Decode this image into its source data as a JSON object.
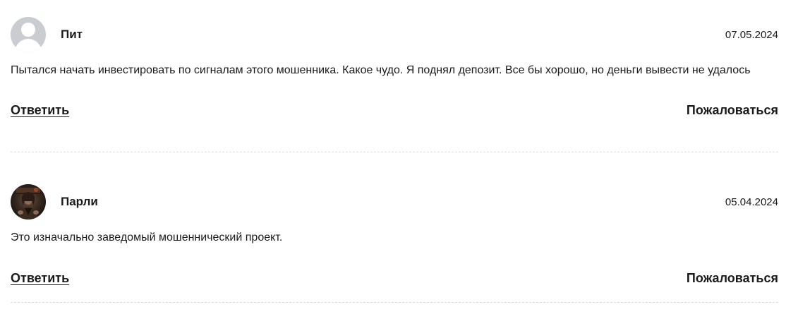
{
  "comments": [
    {
      "author": "Пит",
      "avatar_icon": "user-placeholder-icon",
      "date": "07.05.2024",
      "text": "Пытался начать инвестировать по сигналам этого мошенника. Какое чудо. Я поднял депозит. Все бы хорошо, но деньги вывести не удалось",
      "reply_label": "Ответить",
      "report_label": "Пожаловаться"
    },
    {
      "author": "Парли",
      "avatar_icon": "user-photo",
      "date": "05.04.2024",
      "text": "Это изначально заведомый мошеннический проект.",
      "reply_label": "Ответить",
      "report_label": "Пожаловаться"
    }
  ],
  "colors": {
    "text": "#1a1a1a",
    "avatar_placeholder": "#c9ccd1",
    "divider": "#dcdcdc"
  }
}
